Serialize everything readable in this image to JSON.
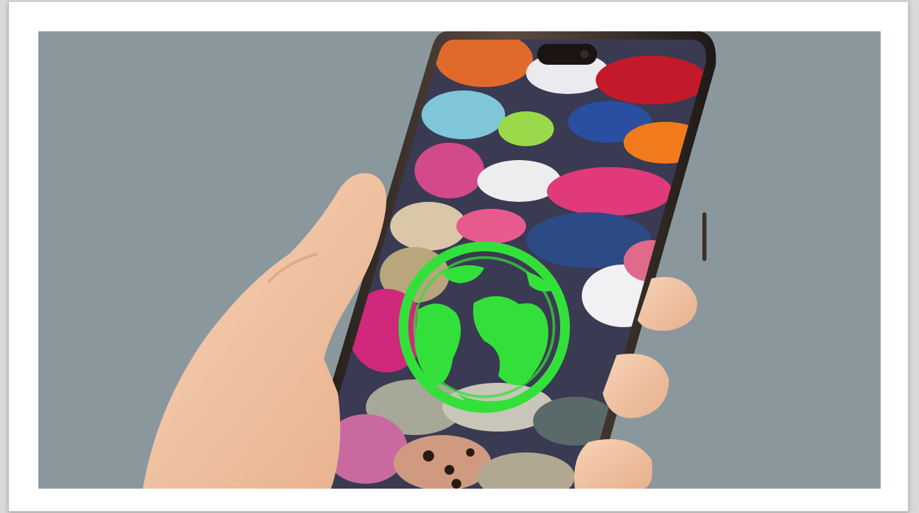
{
  "image": {
    "alt": "",
    "background_color": "#8a989e",
    "frame_color": "#ffffff",
    "globe_color": "#33e03a",
    "phone_frame_color": "#2a221e",
    "skin_color": "#f1c7a6",
    "icons": [
      "globe-icon"
    ]
  }
}
